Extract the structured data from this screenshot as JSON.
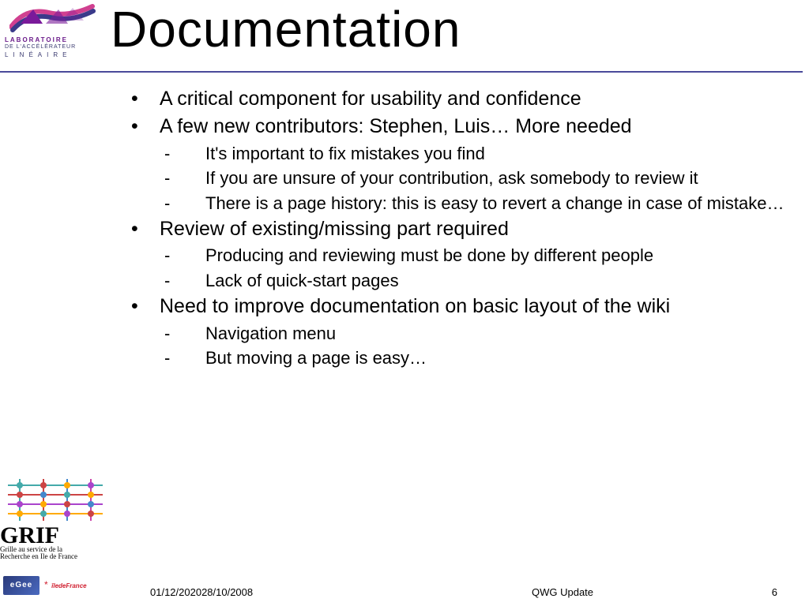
{
  "logo": {
    "line1": "LABORATOIRE",
    "line2": "DE L'ACCÉLÉRATEUR",
    "line3": "LINÉAIRE"
  },
  "title": "Documentation",
  "bullets": [
    {
      "level": 1,
      "text": "A critical component for usability and confidence"
    },
    {
      "level": 1,
      "text": "A few new contributors: Stephen, Luis… More needed"
    },
    {
      "level": 2,
      "text": "It's important to fix mistakes you find"
    },
    {
      "level": 2,
      "text": "If you are unsure of your contribution, ask somebody to review it"
    },
    {
      "level": 2,
      "text": "There is a page history: this is easy to revert a change in case of mistake…"
    },
    {
      "level": 1,
      "text": "Review of existing/missing part required"
    },
    {
      "level": 2,
      "text": "Producing and reviewing must be done by different people"
    },
    {
      "level": 2,
      "text": "Lack of quick-start pages"
    },
    {
      "level": 1,
      "text": "Need to improve documentation on basic layout of the wiki"
    },
    {
      "level": 2,
      "text": "Navigation menu"
    },
    {
      "level": 2,
      "text": "But moving a page is easy…"
    }
  ],
  "grif": {
    "big": "GRIF",
    "line1": "Grille au service de la",
    "line2": "Recherche en Ile de France"
  },
  "egee": "eGee",
  "idf": {
    "star": "*",
    "text": "îledeFrance"
  },
  "footer": {
    "date": "01/12/202028/10/2008",
    "center": "QWG Update",
    "page": "6"
  }
}
